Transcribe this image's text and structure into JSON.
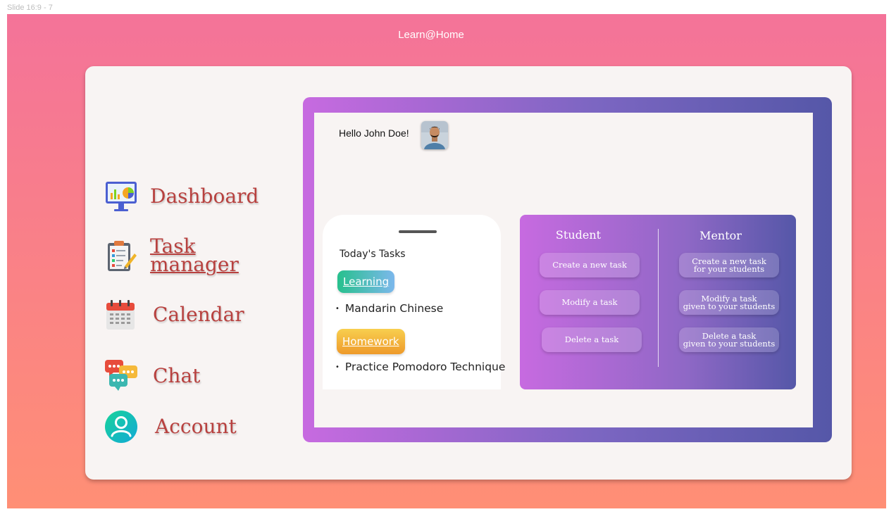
{
  "frame": {
    "label": "Slide 16:9 - 7"
  },
  "header": {
    "title": "Learn@Home"
  },
  "sidebar": {
    "items": [
      {
        "label": "Dashboard",
        "icon": "dashboard-monitor-icon"
      },
      {
        "label_line1": "Task",
        "label_line2": "manager",
        "icon": "clipboard-icon"
      },
      {
        "label": "Calendar",
        "icon": "calendar-icon"
      },
      {
        "label": "Chat",
        "icon": "chat-bubbles-icon"
      },
      {
        "label": "Account",
        "icon": "account-user-icon"
      }
    ]
  },
  "main": {
    "greeting": "Hello John Doe!",
    "tasks": {
      "title": "Today's Tasks",
      "groups": [
        {
          "tag": "Learning",
          "item": "Mandarin Chinese"
        },
        {
          "tag": "Homework",
          "item": "Practice Pomodoro Technique"
        }
      ]
    },
    "roles": {
      "student": {
        "title": "Student",
        "actions": [
          "Create a new task",
          "Modify a task",
          "Delete a task"
        ]
      },
      "mentor": {
        "title": "Mentor",
        "actions": [
          {
            "line1": "Create a new task",
            "line2": "for your students"
          },
          {
            "line1": "Modify a task",
            "line2": "given to your students"
          },
          {
            "line1": "Delete a task",
            "line2": "given to your students"
          }
        ]
      }
    }
  },
  "colors": {
    "background_top": "#f47399",
    "background_bottom": "#ff8f75",
    "nav_text": "#b8413f",
    "panel_gradient_start": "#c76ae0",
    "panel_gradient_end": "#5557a8"
  }
}
